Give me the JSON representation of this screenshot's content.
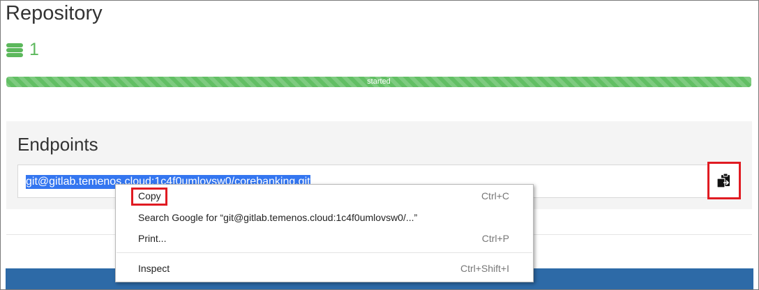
{
  "repository": {
    "title": "Repository",
    "count": "1"
  },
  "progress": {
    "label": "started",
    "fraction": 1.0
  },
  "endpoints": {
    "title": "Endpoints",
    "url": "git@gitlab.temenos.cloud:1c4f0umlovsw0/corebanking.git"
  },
  "copy_button": {
    "icon": "clipboard-copy-icon"
  },
  "context_menu": {
    "items": [
      {
        "label": "Copy",
        "shortcut": "Ctrl+C"
      },
      {
        "label": "Search Google for “git@gitlab.temenos.cloud:1c4f0umlovsw0/...”",
        "shortcut": ""
      },
      {
        "label": "Print...",
        "shortcut": "Ctrl+P"
      },
      {
        "label": "Inspect",
        "shortcut": "Ctrl+Shift+I"
      }
    ]
  },
  "colors": {
    "success": "#5cb85c",
    "selection": "#3476f0",
    "highlight": "#e01b22",
    "footer": "#2d6aa7"
  }
}
